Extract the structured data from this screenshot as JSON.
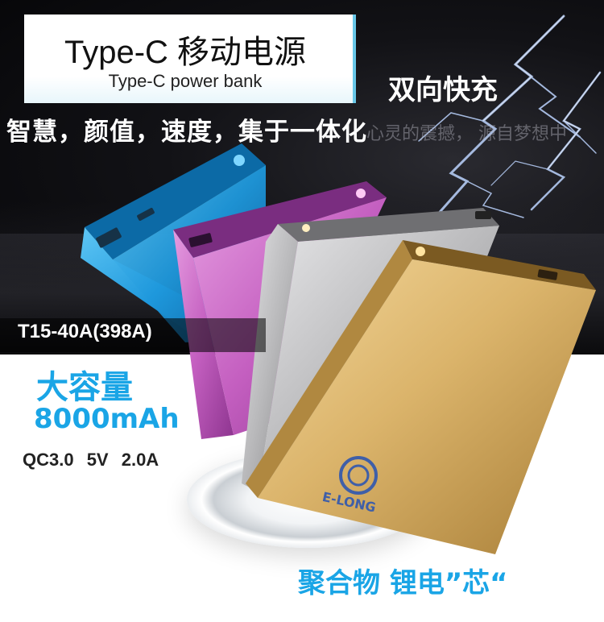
{
  "title": "Type-C 移动电源",
  "subtitle": "Type-C power bank",
  "slogan": "智慧，颜值，速度，集于一体化",
  "fast_charge": "双向快充",
  "background_text": "心灵的震撼，  源自梦想中",
  "model": "T15-40A(398A)",
  "capacity_label": "大容量",
  "capacity_value": "8000mAh",
  "specs": "QC3.0  5V 2.0A",
  "cell_type": "聚合物 锂电”芯“",
  "logo_text": "E-LONG",
  "colors": {
    "accent": "#1aa5e6",
    "blue_device": "#1f9fe0",
    "pink_device": "#c45fc0",
    "silver_device": "#b9b9bb",
    "gold_device": "#d9b36a"
  }
}
